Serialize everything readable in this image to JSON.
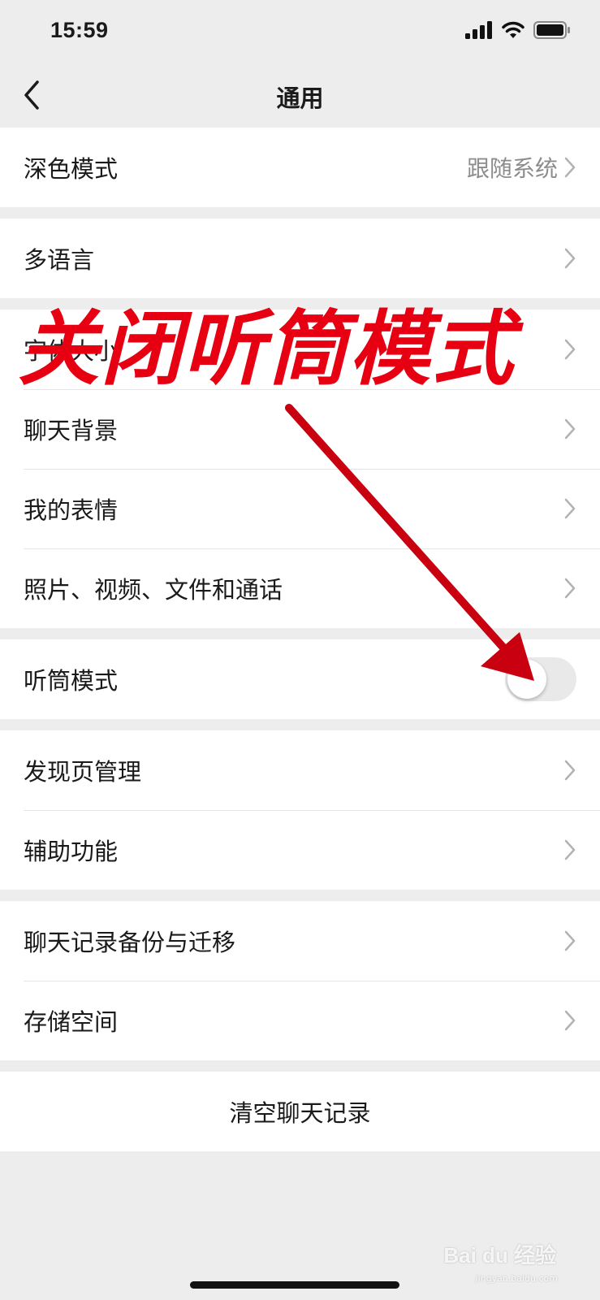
{
  "status_bar": {
    "time": "15:59",
    "icons": [
      "signal-icon",
      "wifi-icon",
      "battery-icon"
    ]
  },
  "nav": {
    "title": "通用",
    "back_icon": "chevron-left-icon"
  },
  "groups": {
    "display": {
      "dark_mode": {
        "label": "深色模式",
        "value": "跟随系统"
      }
    },
    "language": {
      "multi_language": {
        "label": "多语言"
      }
    },
    "chat": {
      "font_size": {
        "label": "字体大小"
      },
      "chat_background": {
        "label": "聊天背景"
      },
      "my_stickers": {
        "label": "我的表情"
      },
      "media": {
        "label": "照片、视频、文件和通话"
      }
    },
    "earpiece": {
      "earpiece_mode": {
        "label": "听筒模式",
        "enabled": false
      }
    },
    "discover": {
      "discover_manage": {
        "label": "发现页管理"
      },
      "accessibility": {
        "label": "辅助功能"
      }
    },
    "storage": {
      "backup": {
        "label": "聊天记录备份与迁移"
      },
      "storage_space": {
        "label": "存储空间"
      }
    },
    "danger": {
      "clear_history": {
        "label": "清空聊天记录"
      }
    }
  },
  "annotation": {
    "text": "关闭听筒模式",
    "color": "#e60012",
    "arrow_color": "#c8000f"
  },
  "watermark": {
    "text": "Bai du 经验",
    "sub": "jingyan.baidu.com"
  },
  "colors": {
    "background": "#ededed",
    "row_background": "#ffffff",
    "secondary_text": "#8c8c8c",
    "toggle_off": "#e9e9ea"
  }
}
